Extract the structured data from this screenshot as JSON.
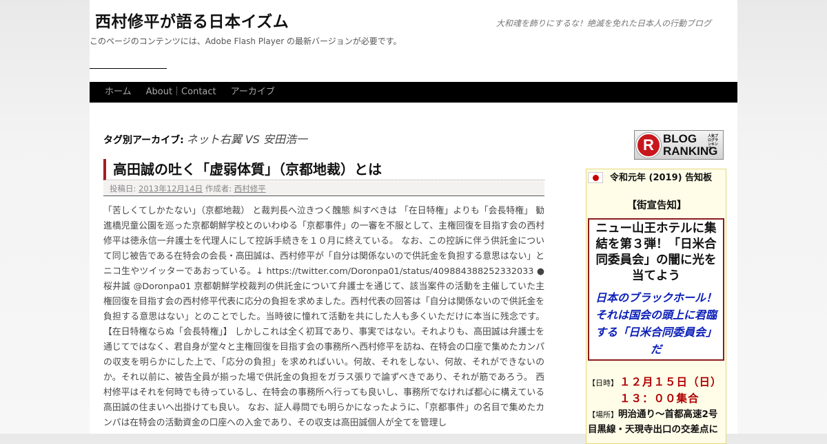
{
  "site": {
    "title": "西村修平が語る日本イズム",
    "description": "大和魂を飾りにするな！絶滅を免れた日本人の行動ブログ",
    "flash_note": "このページのコンテンツには、Adobe Flash Player の最新バージョンが必要です。"
  },
  "menu": [
    {
      "label": "ホーム"
    },
    {
      "label": "About｜Contact"
    },
    {
      "label": "アーカイブ"
    }
  ],
  "archive": {
    "label": "タグ別アーカイブ:",
    "term": "ネット右翼 VS 安田浩一"
  },
  "post": {
    "title": "高田誠の吐く「虚弱体質」（京都地裁）とは",
    "meta": {
      "posted_label": "投稿日:",
      "date": "2013年12月14日",
      "author_label": "作成者:",
      "author": "西村修平"
    },
    "content": "「苦しくてしかたない」（京都地裁） と裁判長へ泣きつく醜態 糾すべきは 「在日特権」よりも「会長特権」 勧進橋児童公園を巡った京都朝鮮学校とのいわゆる「京都事件」の一審を不服として、主権回復を目指す会の西村修平は徳永信一弁護士を代理人にして控訴手続きを１０月に終えている。 なお、この控訴に伴う供託金について同じ被告である在特会の会長・高田誠は、西村修平が「自分は関係ないので供託金を負担する意思はない」とニコ生やツイッターであおっている。↓ https://twitter.com/Doronpa01/status/409884388252332033 ● 桜井誠 @Doronpa01 京都朝鮮学校裁判の供託金について弁護士を通じて、該当案件の活動を主催していた主権回復を目指す会の西村修平代表に応分の負担を求めました。西村代表の回答は「自分は関係ないので供託金を負担する意思はない」とのことでした。当時彼に憧れて活動を共にした人も多くいただけに本当に残念です。 【在日特権ならぬ「会長特権」】 しかしこれは全く初耳であり、事実ではない。それよりも、高田誠は弁護士を通じてではなく、君自身が堂々と主権回復を目指す会の事務所へ西村修平を訪ね、在特会の口座で集めたカンパの収支を明らかにした上で、「応分の負担」を求めればいい。何故、それをしない、何故、それができないのか。それ以前に、被告全員が揃った場で供託金の負担をガラス張りで論ずべきであり、それが筋であろう。 西村修平はそれを何時でも待っているし、在特会の事務所へ行っても良いし、事務所でなければ都心に構えている高田誠の住まいへ出掛けても良い。 なお、証人尋問でも明らかになったように、「京都事件」の名目で集めたカンパは在特会の活動資金の口座への入金であり、その収支は高田誠個人が全てを管理し"
  },
  "sidebar": {
    "blog_ranking": {
      "logo_letter": "R",
      "line1": "BLOG",
      "line2": "RANKING",
      "sub": "人気ブログランキング"
    },
    "widget": {
      "title": "令和元年 (2019) 告知板",
      "notice_heading": "【街宣告知】",
      "notice_main": "ニュー山王ホテルに集結を第３弾！「日米合同委員会」の闇に光を当てよう",
      "notice_sub": "日本のブラックホール！それは国会の頭上に君臨する「日米合同委員会」だ",
      "date_label": "【日時】",
      "date_value": "１２月１５日（日）",
      "time_value": "１３：００集合",
      "place_label": "【場所】",
      "place_value": "明治通り～首都高速2号",
      "place_value2": "目黒線・天現寺出口の交差点に"
    },
    "colors": {
      "accent_red": "#a41e23",
      "notice_blue": "#0b1fb8",
      "date_red": "#b00000"
    }
  }
}
